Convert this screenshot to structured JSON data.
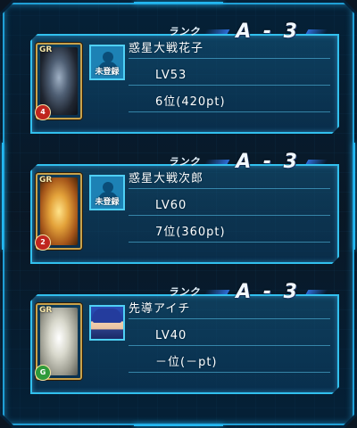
{
  "rank_label": "ランク",
  "entries": [
    {
      "rank": "A - 3",
      "name": "惑星大戦花子",
      "level": "LV53",
      "placement": "6位(420pt)",
      "avatar_state": "未登録",
      "card": {
        "grade": "GR",
        "badge": "4"
      }
    },
    {
      "rank": "A - 3",
      "name": "惑星大戦次郎",
      "level": "LV60",
      "placement": "7位(360pt)",
      "avatar_state": "未登録",
      "card": {
        "grade": "GR",
        "badge": "2"
      }
    },
    {
      "rank": "A - 3",
      "name": "先導アイチ",
      "level": "LV40",
      "placement": "－位(－pt)",
      "avatar_state": "",
      "card": {
        "grade": "GR",
        "badge": "G"
      }
    }
  ],
  "colors": {
    "frame_border": "#1f9fd6",
    "panel_border": "#31c0ee",
    "unregistered_avatar": "#1d82b5"
  },
  "icons": {
    "avatar_placeholder": "person-silhouette-icon",
    "card_art": "unit-card-art"
  }
}
